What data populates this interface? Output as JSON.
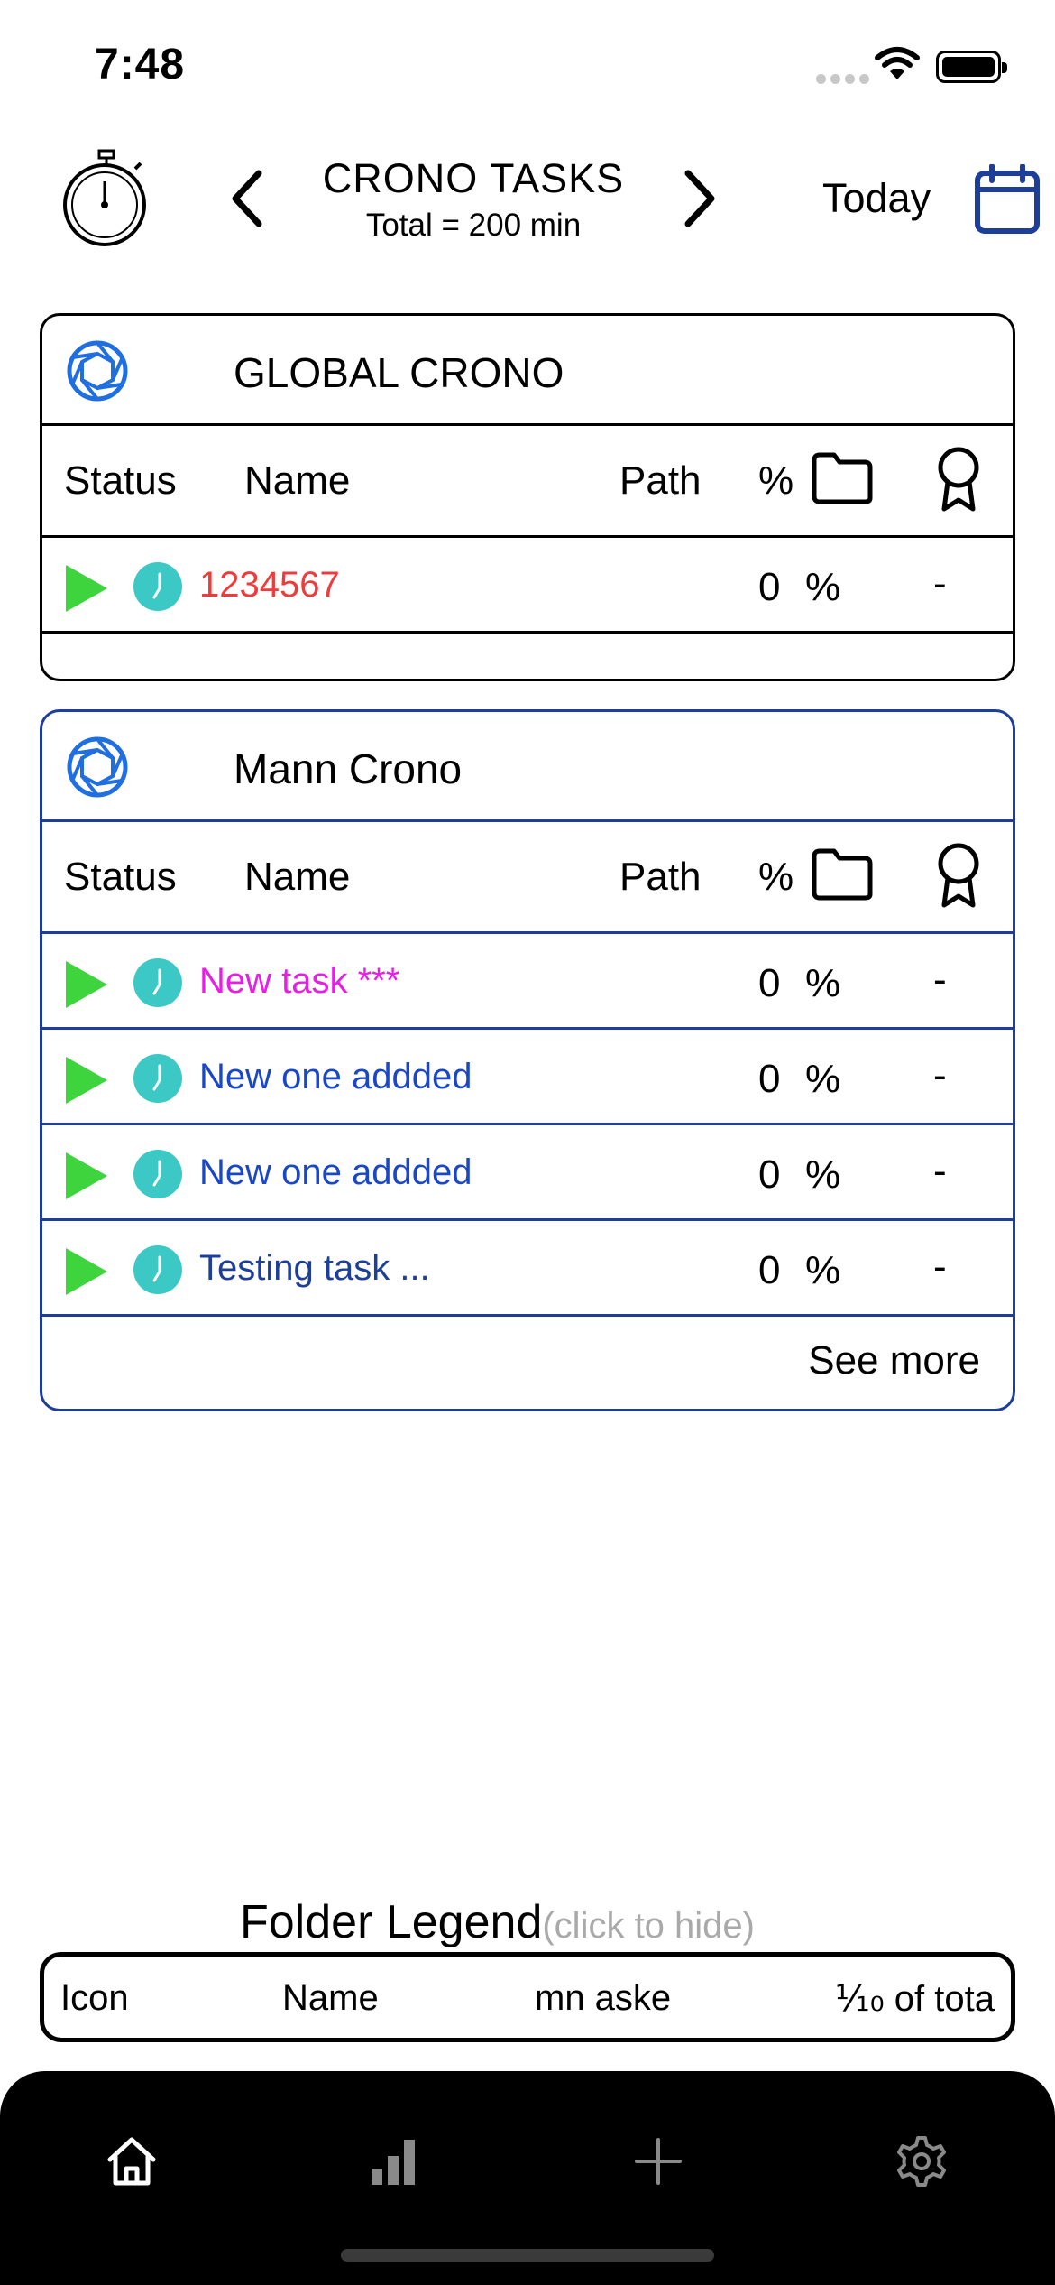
{
  "status_bar": {
    "time": "7:48"
  },
  "header": {
    "title": "CRONO TASKS",
    "subtitle": "Total = 200 min",
    "today_label": "Today"
  },
  "columns": {
    "status": "Status",
    "name": "Name",
    "path": "Path",
    "pct": "%"
  },
  "global_card": {
    "title": "GLOBAL CRONO",
    "border_color": "#000000",
    "tasks": [
      {
        "name": "1234567",
        "color": "#ef3b3b",
        "value": "0",
        "pct": "%",
        "award": "-"
      }
    ]
  },
  "mann_card": {
    "title": "Mann Crono",
    "border_color": "#1d3f9a",
    "tasks": [
      {
        "name": "New task ***",
        "color": "#e91ee6",
        "value": "0",
        "pct": "%",
        "award": "-"
      },
      {
        "name": "New one addded",
        "color": "#1a47c7",
        "value": "0",
        "pct": "%",
        "award": "-"
      },
      {
        "name": "New one addded",
        "color": "#1a47c7",
        "value": "0",
        "pct": "%",
        "award": "-"
      },
      {
        "name": "Testing task ...",
        "color": "#1d3f9a",
        "value": "0",
        "pct": "%",
        "award": "-"
      }
    ],
    "see_more": "See more"
  },
  "legend": {
    "title": "Folder Legend",
    "hint": "(click to hide)",
    "columns": [
      "Icon",
      "Name",
      "mn aske",
      "⅒ of tota"
    ]
  },
  "tabbar": {
    "icons": [
      "home-icon",
      "bar-chart-icon",
      "plus-icon",
      "gear-icon"
    ]
  },
  "colors": {
    "accent_blue": "#1d3f9a",
    "play_green": "#3ed43e",
    "clock_teal": "#3cc8c4",
    "aperture_blue": "#1f6fe0"
  }
}
